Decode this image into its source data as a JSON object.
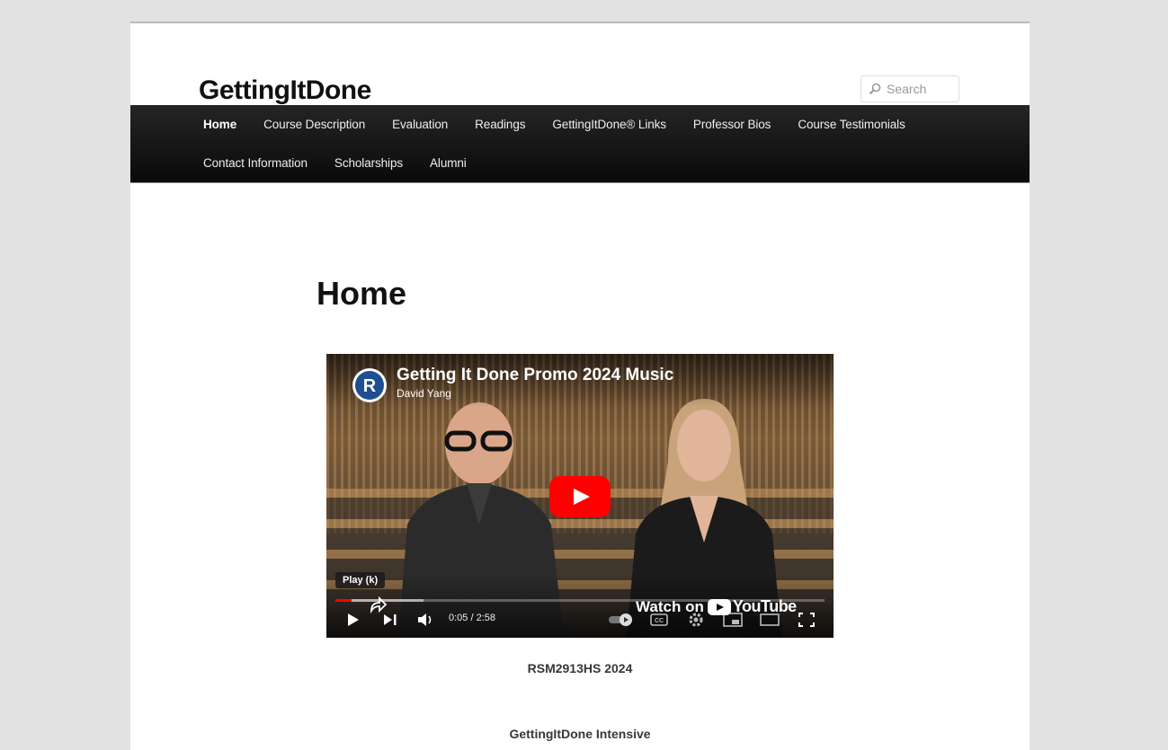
{
  "site": {
    "title": "GettingItDone"
  },
  "search": {
    "placeholder": "Search"
  },
  "nav": {
    "items": [
      {
        "label": "Home",
        "current": true
      },
      {
        "label": "Course Description"
      },
      {
        "label": "Evaluation"
      },
      {
        "label": "Readings"
      },
      {
        "label": "GettingItDone® Links"
      },
      {
        "label": "Professor Bios"
      },
      {
        "label": "Course Testimonials"
      },
      {
        "label": "Contact Information"
      },
      {
        "label": "Scholarships"
      },
      {
        "label": "Alumni"
      }
    ]
  },
  "main": {
    "title": "Home",
    "video": {
      "title": "Getting It Done Promo 2024 Music",
      "channel": "David Yang",
      "tooltip": "Play (k)",
      "time": "0:05 / 2:58",
      "watch_on": "Watch on",
      "youtube": "YouTube",
      "progress_played_fraction": 0.034
    },
    "caption1": "RSM2913HS 2024",
    "caption2": "GettingItDone Intensive"
  },
  "colors": {
    "nav_bg": "#111111",
    "play_red": "#ff0000",
    "page_bg": "#e2e2e2"
  }
}
